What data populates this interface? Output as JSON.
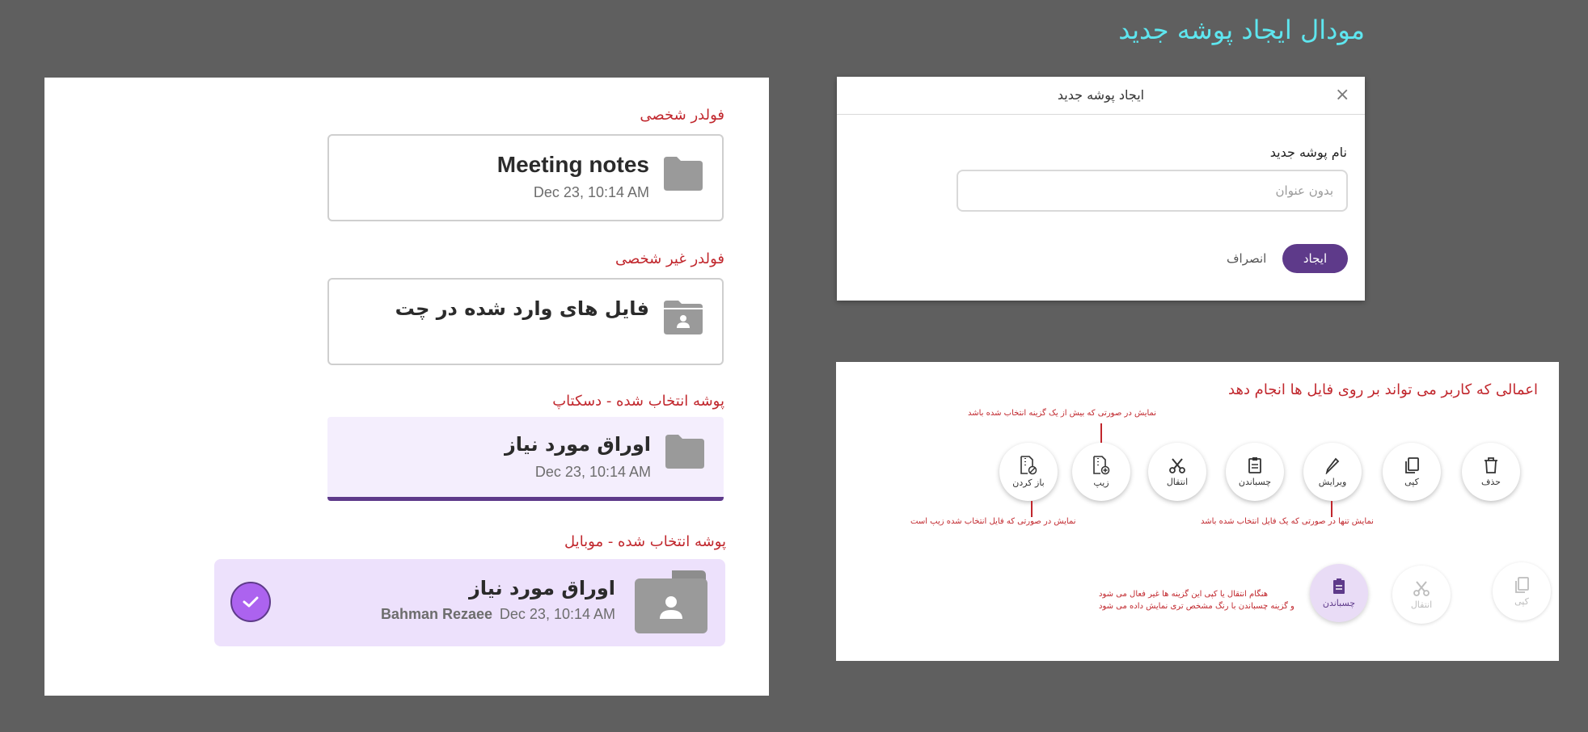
{
  "page_title": "مودال ایجاد پوشه جدید",
  "left": {
    "personal": {
      "label": "فولدر شخصی",
      "title": "Meeting notes",
      "date": "Dec 23, 10:14 AM"
    },
    "shared": {
      "label": "فولدر غیر شخصی",
      "title": "فایل های وارد شده در چت"
    },
    "desktop": {
      "label": "پوشه انتخاب شده - دسکتاپ",
      "title": "اوراق مورد نیاز",
      "date": "Dec 23, 10:14 AM"
    },
    "mobile": {
      "label": "پوشه انتخاب شده - موبایل",
      "title": "اوراق مورد نیاز",
      "date": "Dec 23, 10:14 AM",
      "author": "Bahman Rezaee"
    }
  },
  "modal": {
    "title": "ایجاد پوشه جدید",
    "close": "×",
    "field_label": "نام پوشه جدید",
    "input_value": "",
    "input_placeholder": "بدون عنوان",
    "create": "ایجاد",
    "cancel": "انصراف"
  },
  "actions": {
    "title": "اعمالی که کاربر می تواند بر روی فایل ها انجام دهد",
    "buttons": [
      {
        "label": "حذف",
        "icon": "trash-icon"
      },
      {
        "label": "کپی",
        "icon": "copy-icon"
      },
      {
        "label": "ویرایش",
        "icon": "pencil-icon"
      },
      {
        "label": "چسباندن",
        "icon": "clipboard-icon"
      },
      {
        "label": "انتقال",
        "icon": "scissors-icon"
      },
      {
        "label": "زیپ",
        "icon": "zip-icon"
      },
      {
        "label": "باز کردن",
        "icon": "unzip-icon"
      }
    ],
    "state_buttons": [
      {
        "label": "کپی",
        "icon": "copy-icon",
        "state": "disabled"
      },
      {
        "label": "انتقال",
        "icon": "scissors-icon",
        "state": "disabled"
      },
      {
        "label": "چسباندن",
        "icon": "clipboard-icon",
        "state": "active"
      }
    ],
    "notes": {
      "zip": "نمایش در صورتی که بیش از یک گزینه انتخاب شده باشد",
      "edit": "نمایش تنها در صورتی که یک فایل انتخاب شده باشد",
      "unzip": "نمایش در صورتی که فایل انتخاب شده زیپ است",
      "paste_line1": "هنگام انتقال یا کپی این گزینه ها غیر فعال می شود",
      "paste_line2": "و گزینه چسباندن با رنگ مشخص تری نمایش داده می شود"
    }
  },
  "colors": {
    "accent": "#5e3a8a",
    "note_red": "#c1272d",
    "title_cyan": "#5ee6ef",
    "check_purple": "#ac63ef"
  }
}
